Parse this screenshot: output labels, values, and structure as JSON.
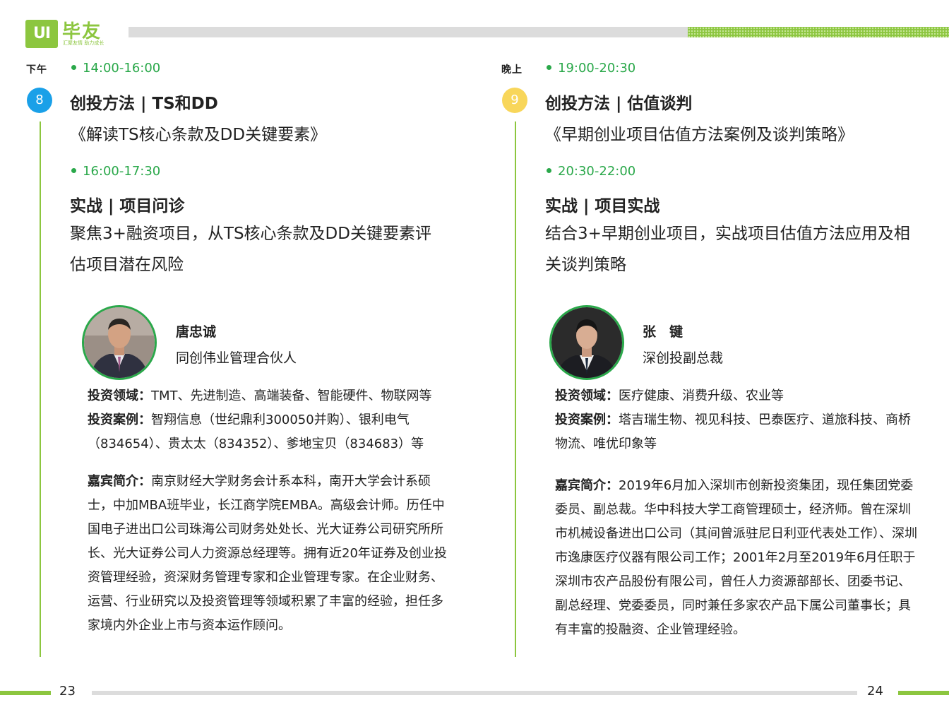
{
  "brand": {
    "logo_mark": "UI",
    "name": "毕友",
    "slogan": "汇聚友情  助力成长",
    "accent_color": "#8cc63f",
    "time_color": "#2aa84a"
  },
  "left": {
    "period": "下午",
    "session1": {
      "number": "8",
      "time": "14:00-16:00",
      "title": "创投方法 | TS和DD",
      "subtitle": "《解读TS核心条款及DD关键要素》"
    },
    "session2": {
      "time": "16:00-17:30",
      "title": "实战 | 项目问诊",
      "desc_line1": "聚焦3+融资项目，从TS核心条款及DD关键要素评",
      "desc_line2": "估项目潜在风险"
    },
    "speaker": {
      "name": "唐忠诚",
      "role": "同创伟业管理合伙人",
      "field_label": "投资领域：",
      "field_value": "TMT、先进制造、高端装备、智能硬件、物联网等",
      "cases_label": "投资案例：",
      "cases_value": "智翔信息（世纪鼎利300050并购）、银利电气（834654）、贵太太（834352）、爹地宝贝（834683）等",
      "bio_label": "嘉宾简介：",
      "bio_value": "南京财经大学财务会计系本科，南开大学会计系硕士，中加MBA班毕业，长江商学院EMBA。高级会计师。历任中国电子进出口公司珠海公司财务处处长、光大证券公司研究所所长、光大证券公司人力资源总经理等。拥有近20年证券及创业投资管理经验，资深财务管理专家和企业管理专家。在企业财务、运营、行业研究以及投资管理等领域积累了丰富的经验，担任多家境内外企业上市与资本运作顾问。"
    },
    "page_number": "23"
  },
  "right": {
    "period": "晚上",
    "session1": {
      "number": "9",
      "time": "19:00-20:30",
      "title": "创投方法 | 估值谈判",
      "subtitle": "《早期创业项目估值方法案例及谈判策略》"
    },
    "session2": {
      "time": "20:30-22:00",
      "title": "实战 | 项目实战",
      "desc_line1": "结合3+早期创业项目，实战项目估值方法应用及相",
      "desc_line2": "关谈判策略"
    },
    "speaker": {
      "name": "张　键",
      "role": "深创投副总裁",
      "field_label": "投资领域：",
      "field_value": "医疗健康、消费升级、农业等",
      "cases_label": "投资案例：",
      "cases_value": "塔吉瑞生物、视见科技、巴泰医疗、道旅科技、商桥物流、唯优印象等",
      "bio_label": "嘉宾简介：",
      "bio_value": "2019年6月加入深圳市创新投资集团，现任集团党委委员、副总裁。华中科技大学工商管理硕士，经济师。曾在深圳市机械设备进出口公司（其间曾派驻尼日利亚代表处工作）、深圳市逸康医疗仪器有限公司工作；2001年2月至2019年6月任职于深圳市农产品股份有限公司，曾任人力资源部部长、团委书记、副总经理、党委委员，同时兼任多家农产品下属公司董事长；具有丰富的投融资、企业管理经验。"
    },
    "page_number": "24"
  },
  "colors": {
    "circle_8": "#1aa0e8",
    "circle_9": "#f8d65a"
  }
}
